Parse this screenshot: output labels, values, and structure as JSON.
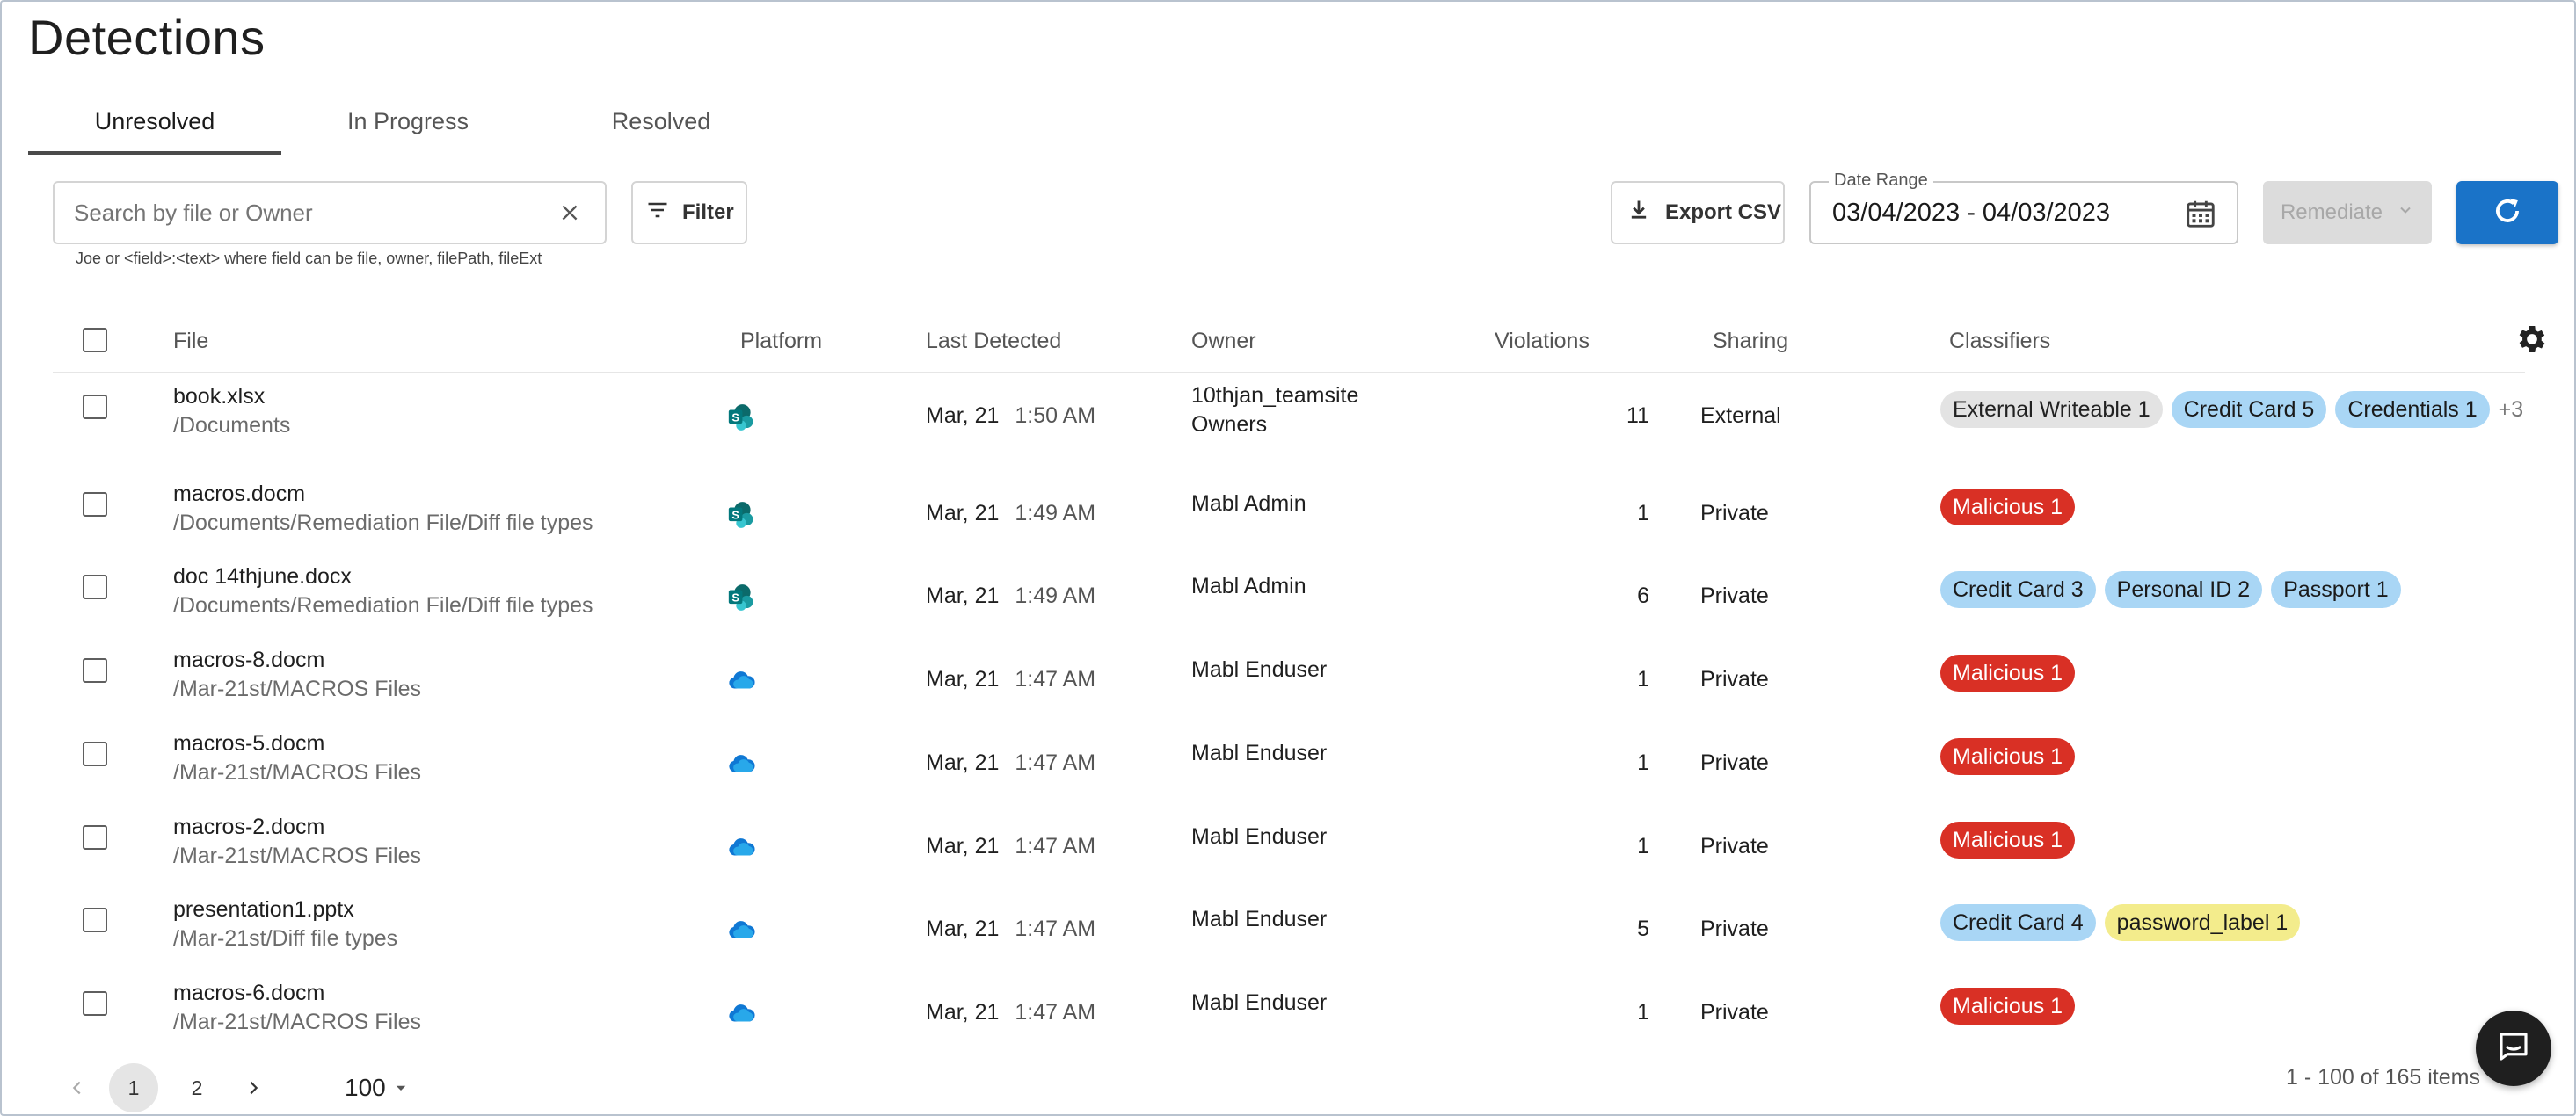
{
  "page": {
    "title": "Detections"
  },
  "tabs": [
    {
      "label": "Unresolved",
      "active": true
    },
    {
      "label": "In Progress",
      "active": false
    },
    {
      "label": "Resolved",
      "active": false
    }
  ],
  "toolbar": {
    "search_placeholder": "Search by file or Owner",
    "search_value": "",
    "search_hint": "Joe or <field>:<text> where field can be file, owner, filePath, fileExt",
    "filter_label": "Filter",
    "export_label": "Export CSV",
    "date_range_label": "Date Range",
    "date_range_value": "03/04/2023 - 04/03/2023",
    "remediate_label": "Remediate"
  },
  "table": {
    "columns": {
      "file": "File",
      "platform": "Platform",
      "last_detected": "Last Detected",
      "owner": "Owner",
      "violations": "Violations",
      "sharing": "Sharing",
      "classifiers": "Classifiers"
    },
    "rows": [
      {
        "file": "book.xlsx",
        "path": "/Documents",
        "platform": "sharepoint-icon",
        "date": "Mar, 21",
        "time": "1:50 AM",
        "owner": "10thjan_teamsite",
        "owner2": "Owners",
        "violations": "11",
        "sharing": "External",
        "classifiers": [
          {
            "label": "External Writeable 1",
            "kind": "grey"
          },
          {
            "label": "Credit Card 5",
            "kind": "blue"
          },
          {
            "label": "Credentials 1",
            "kind": "blue"
          }
        ],
        "more": "+3"
      },
      {
        "file": "macros.docm",
        "path": "/Documents/Remediation File/Diff file types",
        "platform": "sharepoint-icon",
        "date": "Mar, 21",
        "time": "1:49 AM",
        "owner": "Mabl Admin",
        "owner2": "",
        "violations": "1",
        "sharing": "Private",
        "classifiers": [
          {
            "label": "Malicious 1",
            "kind": "red"
          }
        ],
        "more": ""
      },
      {
        "file": "doc 14thjune.docx",
        "path": "/Documents/Remediation File/Diff file types",
        "platform": "sharepoint-icon",
        "date": "Mar, 21",
        "time": "1:49 AM",
        "owner": "Mabl Admin",
        "owner2": "",
        "violations": "6",
        "sharing": "Private",
        "classifiers": [
          {
            "label": "Credit Card 3",
            "kind": "blue"
          },
          {
            "label": "Personal ID 2",
            "kind": "blue"
          },
          {
            "label": "Passport 1",
            "kind": "blue"
          }
        ],
        "more": ""
      },
      {
        "file": "macros-8.docm",
        "path": "/Mar-21st/MACROS Files",
        "platform": "onedrive-icon",
        "date": "Mar, 21",
        "time": "1:47 AM",
        "owner": "Mabl Enduser",
        "owner2": "",
        "violations": "1",
        "sharing": "Private",
        "classifiers": [
          {
            "label": "Malicious 1",
            "kind": "red"
          }
        ],
        "more": ""
      },
      {
        "file": "macros-5.docm",
        "path": "/Mar-21st/MACROS Files",
        "platform": "onedrive-icon",
        "date": "Mar, 21",
        "time": "1:47 AM",
        "owner": "Mabl Enduser",
        "owner2": "",
        "violations": "1",
        "sharing": "Private",
        "classifiers": [
          {
            "label": "Malicious 1",
            "kind": "red"
          }
        ],
        "more": ""
      },
      {
        "file": "macros-2.docm",
        "path": "/Mar-21st/MACROS Files",
        "platform": "onedrive-icon",
        "date": "Mar, 21",
        "time": "1:47 AM",
        "owner": "Mabl Enduser",
        "owner2": "",
        "violations": "1",
        "sharing": "Private",
        "classifiers": [
          {
            "label": "Malicious 1",
            "kind": "red"
          }
        ],
        "more": ""
      },
      {
        "file": "presentation1.pptx",
        "path": "/Mar-21st/Diff file types",
        "platform": "onedrive-icon",
        "date": "Mar, 21",
        "time": "1:47 AM",
        "owner": "Mabl Enduser",
        "owner2": "",
        "violations": "5",
        "sharing": "Private",
        "classifiers": [
          {
            "label": "Credit Card 4",
            "kind": "blue"
          },
          {
            "label": "password_label 1",
            "kind": "yellow"
          }
        ],
        "more": ""
      },
      {
        "file": "macros-6.docm",
        "path": "/Mar-21st/MACROS Files",
        "platform": "onedrive-icon",
        "date": "Mar, 21",
        "time": "1:47 AM",
        "owner": "Mabl Enduser",
        "owner2": "",
        "violations": "1",
        "sharing": "Private",
        "classifiers": [
          {
            "label": "Malicious 1",
            "kind": "red"
          }
        ],
        "more": ""
      }
    ]
  },
  "pagination": {
    "pages": [
      "1",
      "2"
    ],
    "current": "1",
    "page_size": "100",
    "range_text": "1 - 100 of 165 items"
  },
  "colors": {
    "primary": "#1a73c8",
    "chip_red": "#d93025",
    "chip_blue": "#a9d6f5",
    "chip_yellow": "#f3ec8c",
    "chip_grey": "#e3e3e3"
  }
}
